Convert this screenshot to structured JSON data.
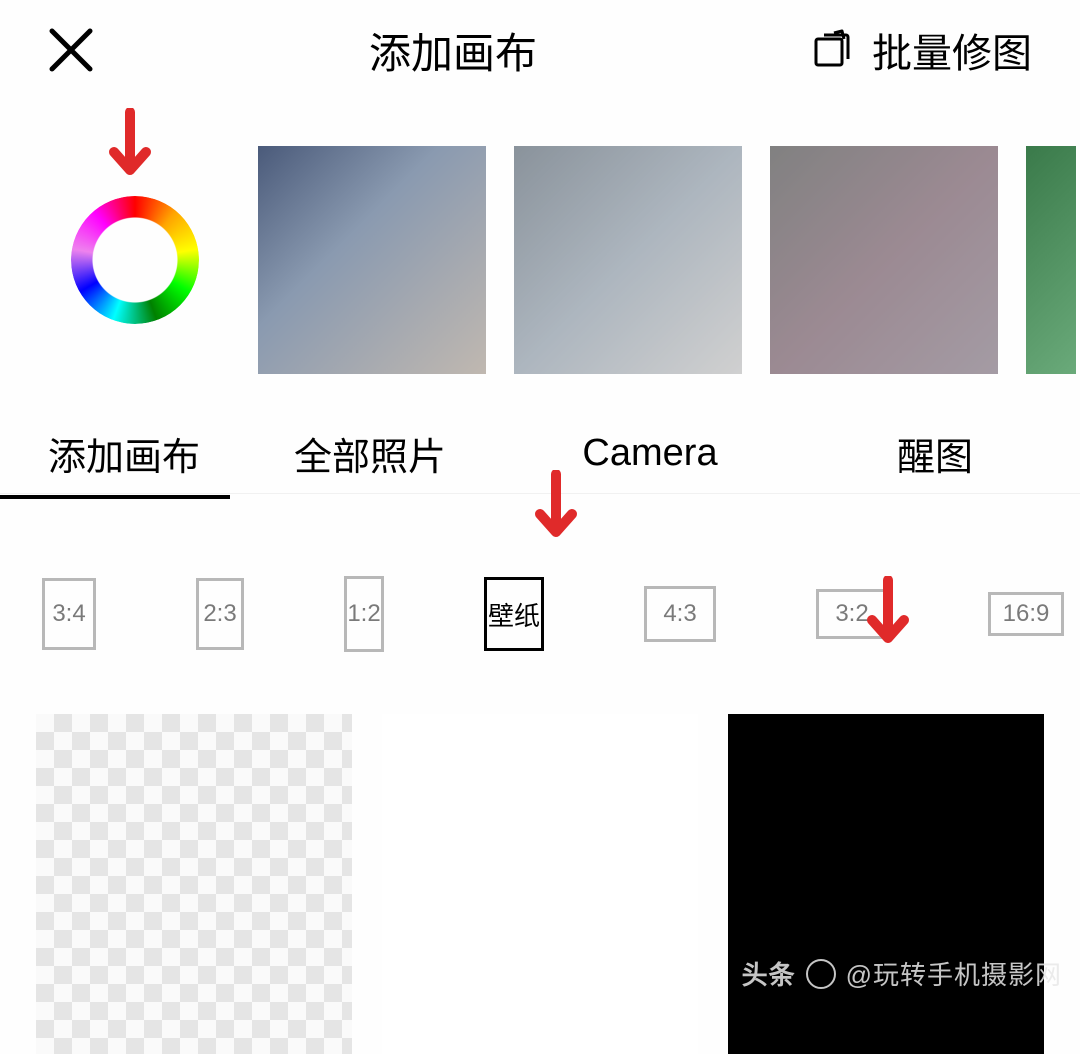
{
  "header": {
    "title": "添加画布",
    "batch_edit_label": "批量修图"
  },
  "tabs": [
    {
      "label": "添加画布",
      "active": true
    },
    {
      "label": "全部照片",
      "active": false
    },
    {
      "label": "Camera",
      "active": false
    },
    {
      "label": "醒图",
      "active": false
    }
  ],
  "ratios": [
    {
      "label": "3:4",
      "class": "r-3-4",
      "selected": false
    },
    {
      "label": "2:3",
      "class": "r-2-3",
      "selected": false
    },
    {
      "label": "1:2",
      "class": "r-1-2",
      "selected": false
    },
    {
      "label": "壁纸",
      "class": "r-wall",
      "selected": true
    },
    {
      "label": "4:3",
      "class": "r-4-3",
      "selected": false
    },
    {
      "label": "3:2",
      "class": "r-3-2",
      "selected": false
    },
    {
      "label": "16:9",
      "class": "r-16-9",
      "selected": false
    }
  ],
  "swatches": [
    {
      "kind": "transparent"
    },
    {
      "kind": "white"
    },
    {
      "kind": "black"
    }
  ],
  "watermark": {
    "brand": "头条",
    "handle": "@玩转手机摄影网"
  },
  "arrow_color": "#e02a2a"
}
